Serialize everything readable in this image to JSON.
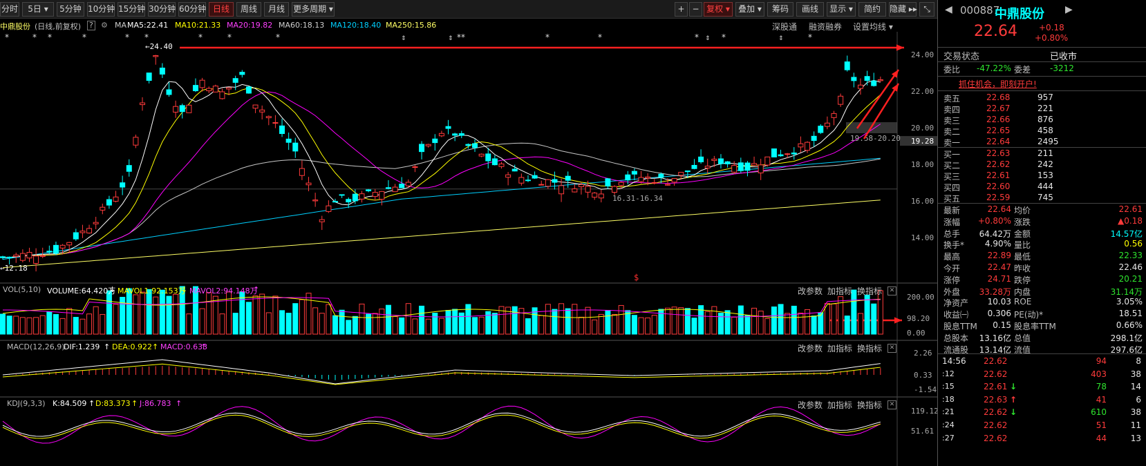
{
  "toolbar": {
    "left_buttons": [
      "分时",
      "5日 ▾",
      "5分钟",
      "10分钟",
      "15分钟",
      "30分钟",
      "60分钟",
      "日线",
      "周线",
      "月线",
      "更多周期 ▾"
    ],
    "right_buttons": [
      "+",
      "−",
      "复权 ▾",
      "叠加 ▾",
      "筹码",
      "画线",
      "显示 ▾",
      "简约",
      "隐藏 ▸▸",
      "⤡"
    ]
  },
  "info": {
    "stock": "中鼎股份",
    "mode": "(日线,前复权)",
    "help": "?",
    "ma_label": "MA",
    "ma5": "MA5:22.41",
    "ma10": "MA10:21.33",
    "ma20": "MA20:19.82",
    "ma60": "MA60:18.13",
    "ma120": "MA120:18.40",
    "ma250": "MA250:15.86",
    "links": [
      "深股通",
      "融资融券",
      "设置均线 ▾"
    ]
  },
  "price_axis": [
    "24.00",
    "22.00",
    "20.00",
    "18.00",
    "16.00",
    "14.00"
  ],
  "price_marker": "19.28",
  "annotations": {
    "high": "←24.40",
    "low": "←12.18",
    "range1": "19.58-20.20",
    "range2": "16.31-16.34",
    "dollar": "$"
  },
  "vol": {
    "title": "VOL(5,10)",
    "volume": "VOLUME:64.420万",
    "mavol1": "MAVOL1:92.153万",
    "mavol2": "MAVOL2:94.148万",
    "axis": [
      "200.00",
      "98.20",
      "0.00"
    ]
  },
  "macd": {
    "title": "MACD(12,26,9)",
    "dif": "DIF:1.239",
    "dea": "DEA:0.922",
    "macd": "MACD:0.633",
    "axis": [
      "2.26",
      "0.33",
      "-1.54"
    ]
  },
  "kdj": {
    "title": "KDJ(9,3,3)",
    "k": "K:84.509",
    "d": "D:83.373",
    "j": "J:86.783",
    "axis": [
      "119.12",
      "51.61"
    ]
  },
  "panel_buttons": [
    "改参数",
    "加指标",
    "换指标"
  ],
  "colors": {
    "up": "#ff3b3b",
    "down": "#00ffff",
    "ma5": "#ffffff",
    "ma10": "#ffff00",
    "ma20": "#ff00ff",
    "ma60": "#c8c8c8",
    "ma120": "#00d0ff",
    "ma250": "#ffff66",
    "arrow": "#ff2020"
  },
  "quote": {
    "code": "000887",
    "name": "中鼎股份",
    "price": "22.64",
    "change": "+0.18",
    "change_pct": "+0.80%",
    "status_label": "交易状态",
    "status_value": "已收市",
    "weibi_label": "委比",
    "weibi_value": "-47.22%",
    "weicha_label": "委差",
    "weicha_value": "-3212",
    "promo": "抓住机会，即刻开户!",
    "asks": [
      {
        "label": "卖五",
        "price": "22.68",
        "vol": "957"
      },
      {
        "label": "卖四",
        "price": "22.67",
        "vol": "221"
      },
      {
        "label": "卖三",
        "price": "22.66",
        "vol": "876"
      },
      {
        "label": "卖二",
        "price": "22.65",
        "vol": "458"
      },
      {
        "label": "卖一",
        "price": "22.64",
        "vol": "2495"
      }
    ],
    "bids": [
      {
        "label": "买一",
        "price": "22.63",
        "vol": "211"
      },
      {
        "label": "买二",
        "price": "22.62",
        "vol": "242"
      },
      {
        "label": "买三",
        "price": "22.61",
        "vol": "153"
      },
      {
        "label": "买四",
        "price": "22.60",
        "vol": "444"
      },
      {
        "label": "买五",
        "price": "22.59",
        "vol": "745"
      }
    ],
    "stats": [
      [
        "最新",
        "22.64",
        "均价",
        "22.61"
      ],
      [
        "涨幅",
        "+0.80%",
        "涨跌",
        "▲0.18"
      ],
      [
        "总手",
        "64.42万",
        "金额",
        "14.57亿"
      ],
      [
        "换手*",
        "4.90%",
        "量比",
        "0.56"
      ],
      [
        "最高",
        "22.89",
        "最低",
        "22.33"
      ],
      [
        "今开",
        "22.47",
        "昨收",
        "22.46"
      ],
      [
        "涨停",
        "24.71",
        "跌停",
        "20.21"
      ],
      [
        "外盘",
        "33.28万",
        "内盘",
        "31.14万"
      ],
      [
        "净资产",
        "10.03",
        "ROE",
        "3.05%"
      ],
      [
        "收益㈠",
        "0.306",
        "PE(动)*",
        "18.51"
      ],
      [
        "股息TTM",
        "0.15",
        "股息率TTM",
        "0.66%"
      ],
      [
        "总股本",
        "13.16亿",
        "总值",
        "298.1亿"
      ],
      [
        "流通股",
        "13.14亿",
        "流值",
        "297.6亿"
      ]
    ],
    "ticks": [
      {
        "time": "14:56",
        "price": "22.62",
        "vol": "94",
        "num": "8",
        "arrow": ""
      },
      {
        "time": ":12",
        "price": "22.62",
        "vol": "403",
        "num": "38",
        "arrow": ""
      },
      {
        "time": ":15",
        "price": "22.61",
        "vol": "78",
        "num": "14",
        "arrow": "↓"
      },
      {
        "time": ":18",
        "price": "22.63",
        "vol": "41",
        "num": "6",
        "arrow": "↑"
      },
      {
        "time": ":21",
        "price": "22.62",
        "vol": "610",
        "num": "38",
        "arrow": "↓"
      },
      {
        "time": ":24",
        "price": "22.62",
        "vol": "51",
        "num": "11",
        "arrow": ""
      },
      {
        "time": ":27",
        "price": "22.62",
        "vol": "44",
        "num": "13",
        "arrow": ""
      }
    ]
  }
}
